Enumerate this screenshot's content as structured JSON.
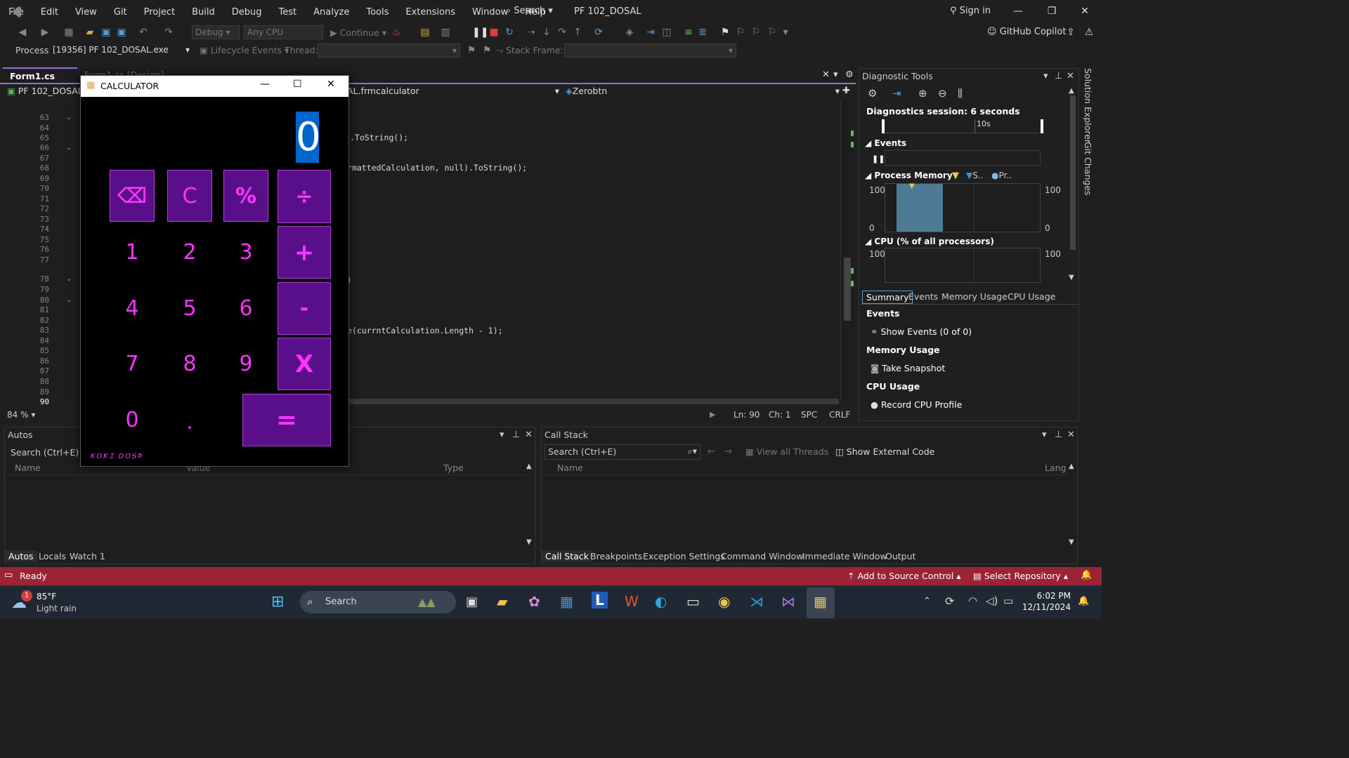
{
  "menubar": {
    "items": [
      "File",
      "Edit",
      "View",
      "Git",
      "Project",
      "Build",
      "Debug",
      "Test",
      "Analyze",
      "Tools",
      "Extensions",
      "Window",
      "Help"
    ],
    "search": "Search",
    "solution": "PF 102_DOSAL",
    "sign_in": "Sign in"
  },
  "toolbar": {
    "config": "Debug",
    "platform": "Any CPU",
    "continue": "Continue",
    "copilot": "GitHub Copilot",
    "process_label": "Process:",
    "process_value": "[19356] PF 102_DOSAL.exe",
    "lifecycle": "Lifecycle Events",
    "thread_label": "Thread:",
    "stackframe_label": "Stack Frame:"
  },
  "editor": {
    "tab_active": "Form1.cs",
    "tab_inactive": "Form1.cs [Design]",
    "project_combo": "PF 102_DOSAL",
    "class_combo": "AL.frmcalculator",
    "member_combo": "Zerobtn",
    "line_numbers": [
      "63",
      "64",
      "65",
      "66",
      "67",
      "68",
      "69",
      "70",
      "71",
      "72",
      "73",
      "74",
      "75",
      "76",
      "77",
      "78",
      "79",
      "80",
      "81",
      "82",
      "83",
      "84",
      "85",
      "86",
      "87",
      "88",
      "89",
      "90"
    ],
    "code_line_65": ".ToString();",
    "code_line_68": "rmattedCalculation, null).ToString();",
    "code_line_78": ")",
    "code_line_83": "e(currntCalculation.Length - 1);",
    "zoom": "84 %",
    "ln": "Ln: 90",
    "ch": "Ch: 1",
    "spc": "SPC",
    "crlf": "CRLF"
  },
  "diagnostics": {
    "title": "Diagnostic Tools",
    "session": "Diagnostics session: 6 seconds",
    "timeline_label": "10s",
    "events_header": "Events",
    "process_memory": "Process Memory",
    "legend_s": "S..",
    "legend_pr": "Pr..",
    "mem_max": "100",
    "mem_min": "0",
    "cpu_header": "CPU (% of all processors)",
    "cpu_max": "100",
    "tabs": [
      "Summary",
      "Events",
      "Memory Usage",
      "CPU Usage"
    ],
    "events_section": "Events",
    "show_events": "Show Events (0 of 0)",
    "memory_section": "Memory Usage",
    "take_snapshot": "Take Snapshot",
    "cpu_section": "CPU Usage",
    "record_cpu": "Record CPU Profile"
  },
  "autos": {
    "title": "Autos",
    "search": "Search (Ctrl+E)",
    "col_name": "Name",
    "col_value": "Value",
    "col_type": "Type",
    "tabs": [
      "Autos",
      "Locals",
      "Watch 1"
    ]
  },
  "callstack": {
    "title": "Call Stack",
    "search": "Search (Ctrl+E)",
    "view_threads": "View all Threads",
    "show_external": "Show External Code",
    "col_name": "Name",
    "col_lang": "Lang",
    "tabs": [
      "Call Stack",
      "Breakpoints",
      "Exception Settings",
      "Command Window",
      "Immediate Window",
      "Output"
    ]
  },
  "sidepanel": {
    "solution_explorer": "Solution Explorer",
    "git_changes": "Git Changes"
  },
  "statusbar": {
    "ready": "Ready",
    "source_control": "Add to Source Control",
    "repository": "Select Repository"
  },
  "calculator": {
    "title": "CALCULATOR",
    "display": "0",
    "buttons": {
      "back": "⌫",
      "clear": "C",
      "percent": "%",
      "divide": "÷",
      "plus": "+",
      "minus": "-",
      "multiply": "X",
      "equals": "=",
      "n1": "1",
      "n2": "2",
      "n3": "3",
      "n4": "4",
      "n5": "5",
      "n6": "6",
      "n7": "7",
      "n8": "8",
      "n9": "9",
      "n0": "0",
      "dot": "."
    },
    "signature": "ꝀOꝀꞮ DOꞨꝤ"
  },
  "taskbar": {
    "weather_temp": "85°F",
    "weather_desc": "Light rain",
    "weather_badge": "1",
    "search": "Search",
    "time": "6:02 PM",
    "date": "12/11/2024"
  },
  "colors": {
    "accent_purple": "#9b6bdf",
    "status_red": "#9b2335",
    "calc_button_bg": "#5a0f8a",
    "calc_text_magenta": "#ff33ff",
    "display_highlight": "#0066cc"
  }
}
